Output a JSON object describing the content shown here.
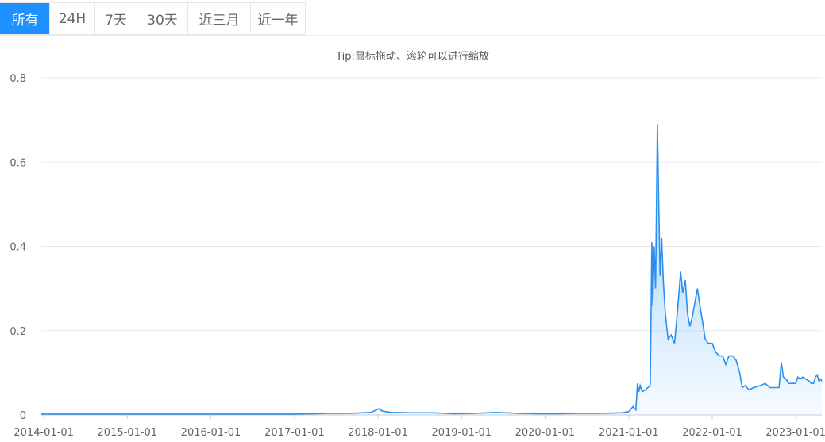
{
  "tabs": [
    {
      "label": "所有",
      "active": true
    },
    {
      "label": "24H",
      "active": false
    },
    {
      "label": "7天",
      "active": false
    },
    {
      "label": "30天",
      "active": false
    },
    {
      "label": "近三月",
      "active": false
    },
    {
      "label": "近一年",
      "active": false
    }
  ],
  "tip": "Tip:鼠标拖动、滚轮可以进行缩放",
  "colors": {
    "accent": "#1e90ff",
    "line": "#2b8ff0"
  },
  "chart_data": {
    "type": "area",
    "title": "",
    "xlabel": "",
    "ylabel": "",
    "ylim": [
      0,
      0.8
    ],
    "yticks": [
      0,
      0.2,
      0.4,
      0.6,
      0.8
    ],
    "ytick_labels": [
      "0",
      "0.2",
      "0.4",
      "0.6",
      "0.8"
    ],
    "xticks": [
      "2014-01-01",
      "2015-01-01",
      "2016-01-01",
      "2017-01-01",
      "2018-01-01",
      "2019-01-01",
      "2020-01-01",
      "2021-01-01",
      "2022-01-01",
      "2023-01-01"
    ],
    "xlim": [
      "2013-12-21",
      "2023-04-25"
    ],
    "grid": true,
    "series": [
      {
        "name": "",
        "points": [
          [
            "2013-12-21",
            0.002
          ],
          [
            "2014-06-01",
            0.002
          ],
          [
            "2015-01-01",
            0.002
          ],
          [
            "2016-01-01",
            0.002
          ],
          [
            "2017-01-01",
            0.002
          ],
          [
            "2017-04-01",
            0.003
          ],
          [
            "2017-06-01",
            0.004
          ],
          [
            "2017-09-01",
            0.004
          ],
          [
            "2017-12-01",
            0.006
          ],
          [
            "2018-01-05",
            0.015
          ],
          [
            "2018-01-20",
            0.009
          ],
          [
            "2018-03-01",
            0.006
          ],
          [
            "2018-06-01",
            0.005
          ],
          [
            "2018-09-01",
            0.005
          ],
          [
            "2018-12-01",
            0.003
          ],
          [
            "2019-03-01",
            0.004
          ],
          [
            "2019-06-01",
            0.006
          ],
          [
            "2019-09-01",
            0.004
          ],
          [
            "2019-12-01",
            0.003
          ],
          [
            "2020-03-01",
            0.003
          ],
          [
            "2020-06-01",
            0.004
          ],
          [
            "2020-09-01",
            0.004
          ],
          [
            "2020-12-01",
            0.005
          ],
          [
            "2021-01-01",
            0.008
          ],
          [
            "2021-01-20",
            0.02
          ],
          [
            "2021-02-01",
            0.012
          ],
          [
            "2021-02-08",
            0.075
          ],
          [
            "2021-02-14",
            0.055
          ],
          [
            "2021-02-20",
            0.07
          ],
          [
            "2021-03-01",
            0.055
          ],
          [
            "2021-03-15",
            0.06
          ],
          [
            "2021-04-05",
            0.07
          ],
          [
            "2021-04-12",
            0.41
          ],
          [
            "2021-04-16",
            0.26
          ],
          [
            "2021-04-22",
            0.4
          ],
          [
            "2021-04-28",
            0.3
          ],
          [
            "2021-05-06",
            0.69
          ],
          [
            "2021-05-12",
            0.5
          ],
          [
            "2021-05-18",
            0.33
          ],
          [
            "2021-05-25",
            0.42
          ],
          [
            "2021-06-01",
            0.32
          ],
          [
            "2021-06-10",
            0.24
          ],
          [
            "2021-06-22",
            0.18
          ],
          [
            "2021-07-05",
            0.19
          ],
          [
            "2021-07-20",
            0.17
          ],
          [
            "2021-08-01",
            0.24
          ],
          [
            "2021-08-16",
            0.34
          ],
          [
            "2021-08-25",
            0.29
          ],
          [
            "2021-09-05",
            0.32
          ],
          [
            "2021-09-15",
            0.24
          ],
          [
            "2021-09-25",
            0.21
          ],
          [
            "2021-10-05",
            0.23
          ],
          [
            "2021-10-18",
            0.27
          ],
          [
            "2021-10-28",
            0.3
          ],
          [
            "2021-11-08",
            0.26
          ],
          [
            "2021-11-20",
            0.22
          ],
          [
            "2021-12-01",
            0.18
          ],
          [
            "2021-12-15",
            0.17
          ],
          [
            "2022-01-01",
            0.17
          ],
          [
            "2022-01-15",
            0.15
          ],
          [
            "2022-02-01",
            0.14
          ],
          [
            "2022-02-15",
            0.14
          ],
          [
            "2022-03-01",
            0.12
          ],
          [
            "2022-03-15",
            0.14
          ],
          [
            "2022-04-01",
            0.14
          ],
          [
            "2022-04-15",
            0.13
          ],
          [
            "2022-05-01",
            0.1
          ],
          [
            "2022-05-12",
            0.065
          ],
          [
            "2022-05-25",
            0.07
          ],
          [
            "2022-06-10",
            0.06
          ],
          [
            "2022-07-01",
            0.065
          ],
          [
            "2022-08-01",
            0.07
          ],
          [
            "2022-08-20",
            0.075
          ],
          [
            "2022-09-10",
            0.065
          ],
          [
            "2022-10-01",
            0.065
          ],
          [
            "2022-10-20",
            0.065
          ],
          [
            "2022-10-30",
            0.125
          ],
          [
            "2022-11-08",
            0.09
          ],
          [
            "2022-11-20",
            0.085
          ],
          [
            "2022-12-01",
            0.075
          ],
          [
            "2022-12-15",
            0.075
          ],
          [
            "2023-01-01",
            0.075
          ],
          [
            "2023-01-10",
            0.09
          ],
          [
            "2023-01-20",
            0.085
          ],
          [
            "2023-02-01",
            0.09
          ],
          [
            "2023-02-15",
            0.085
          ],
          [
            "2023-03-01",
            0.08
          ],
          [
            "2023-03-10",
            0.075
          ],
          [
            "2023-03-20",
            0.075
          ],
          [
            "2023-03-28",
            0.09
          ],
          [
            "2023-04-05",
            0.095
          ],
          [
            "2023-04-12",
            0.08
          ],
          [
            "2023-04-20",
            0.085
          ],
          [
            "2023-04-25",
            0.08
          ]
        ]
      }
    ]
  }
}
